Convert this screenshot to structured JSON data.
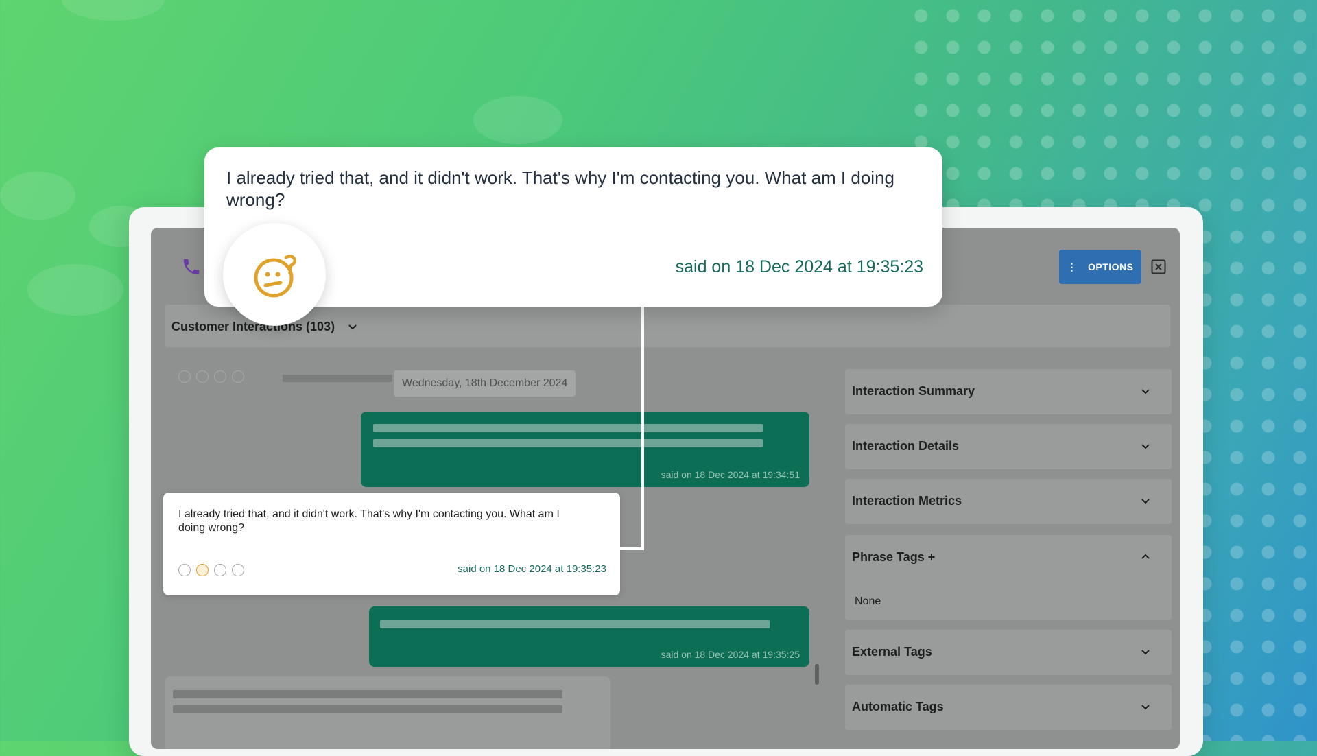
{
  "callout": {
    "text": "I already tried that, and it didn't work. That's why I'm contacting you. What am I doing wrong?",
    "timestamp": "said on 18 Dec 2024 at 19:35:23",
    "sentiment_icon": "confused-face-icon"
  },
  "toolbar": {
    "options_label": "OPTIONS"
  },
  "section": {
    "title": "Customer Interactions (103)"
  },
  "conversation": {
    "date_label": "Wednesday, 18th December 2024",
    "agent_message_1": {
      "timestamp": "said on 18 Dec 2024 at 19:34:51"
    },
    "customer_message": {
      "text": "I already tried that, and it didn't work. That's why I'm contacting you. What am I doing wrong?",
      "timestamp": "said on 18 Dec 2024 at 19:35:23"
    },
    "agent_message_2": {
      "timestamp": "said on 18 Dec 2024 at 19:35:25"
    }
  },
  "side_panels": [
    {
      "title": "Interaction Summary",
      "expanded": false
    },
    {
      "title": "Interaction Details",
      "expanded": false
    },
    {
      "title": "Interaction Metrics",
      "expanded": false
    },
    {
      "title": "Phrase Tags +",
      "expanded": true,
      "body": "None"
    },
    {
      "title": "External Tags",
      "expanded": false
    },
    {
      "title": "Automatic Tags",
      "expanded": false
    }
  ],
  "colors": {
    "agent_bubble": "#0c6e55",
    "options_button": "#2f6fb1",
    "sentiment_accent": "#e0a22a",
    "phone_icon": "#6b3ea3"
  }
}
